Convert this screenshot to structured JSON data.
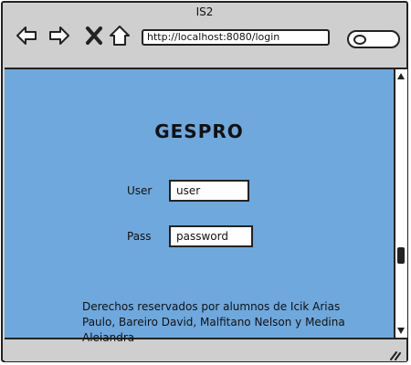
{
  "window": {
    "title": "IS2"
  },
  "toolbar": {
    "back_icon": "back-arrow-icon",
    "forward_icon": "forward-arrow-icon",
    "close_icon": "close-icon",
    "home_icon": "home-icon",
    "url": "http://localhost:8080/login",
    "search_icon": "search-icon"
  },
  "page": {
    "title": "GESPRO",
    "user_label": "User",
    "user_value": "user",
    "pass_label": "Pass",
    "pass_value": "password",
    "footer": "Derechos reservados por alumnos de Icik Arias Paulo, Bareiro David, Malfitano Nelson y Medina Alejandra"
  },
  "colors": {
    "page_background": "#6fa8dc",
    "chrome": "#cfcfcf"
  }
}
